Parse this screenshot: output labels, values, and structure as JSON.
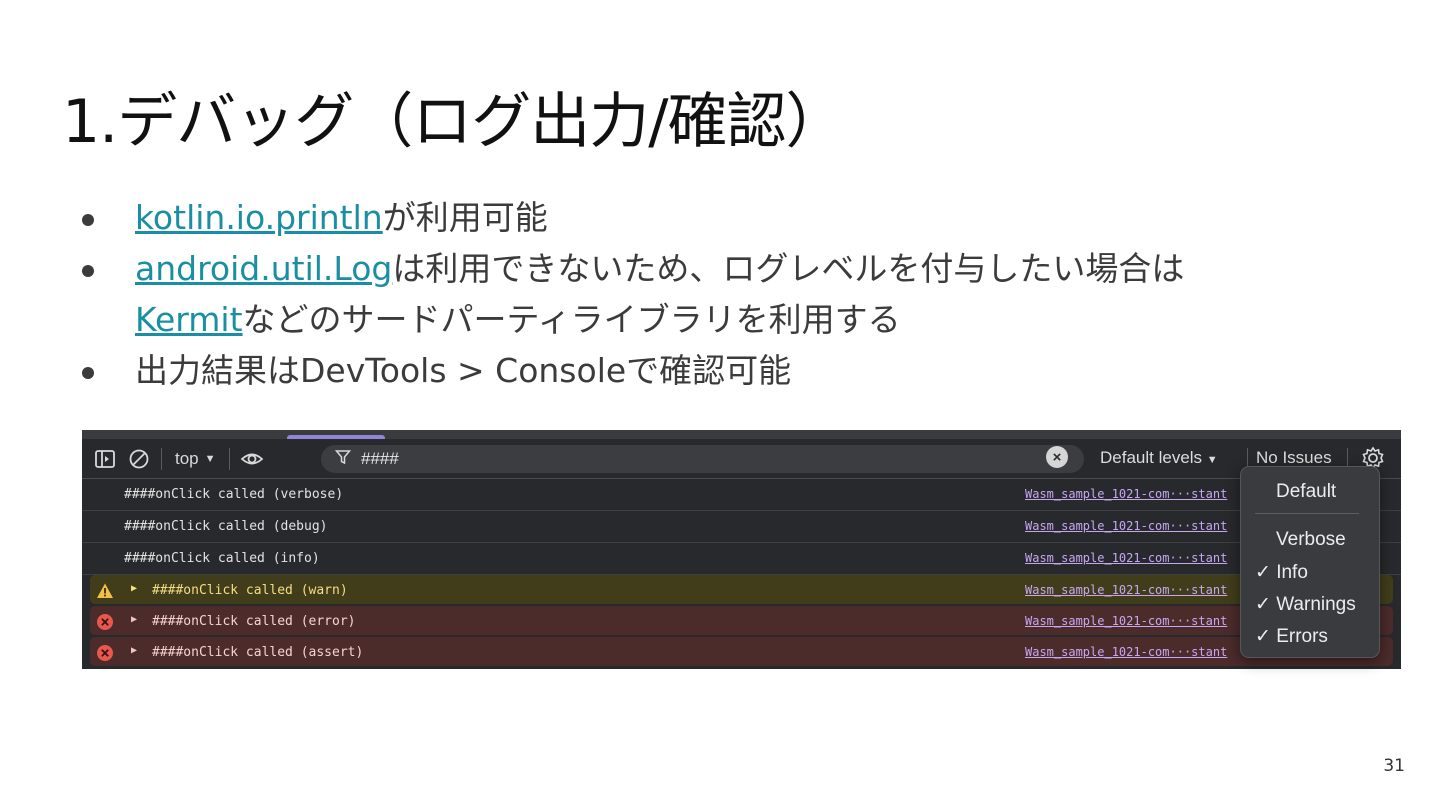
{
  "slide": {
    "title": "1.デバッグ（ログ出力/確認）",
    "bullets": [
      {
        "link": "kotlin.io.println",
        "text": "が利用可能"
      },
      {
        "link": "android.util.Log",
        "text": "は利用できないため、ログレベルを付与したい場合は"
      },
      {
        "link": "Kermit",
        "text": "などのサードパーティライブラリを利用する"
      },
      {
        "text": "出力結果はDevTools > Consoleで確認可能"
      }
    ],
    "page_number": "31"
  },
  "devtools": {
    "toolbar": {
      "context": "top",
      "filter_value": "####",
      "levels_label": "Default levels",
      "issues_label": "No Issues"
    },
    "logs": [
      {
        "level": "verbose",
        "message": "####onClick called (verbose)",
        "source": "Wasm_sample_1021-com···stant"
      },
      {
        "level": "debug",
        "message": "####onClick called (debug)",
        "source": "Wasm_sample_1021-com···stant"
      },
      {
        "level": "info",
        "message": "####onClick called (info)",
        "source": "Wasm_sample_1021-com···stant"
      },
      {
        "level": "warn",
        "message": "####onClick called (warn)",
        "source": "Wasm_sample_1021-com···stant"
      },
      {
        "level": "error",
        "message": "####onClick called (error)",
        "source": "Wasm_sample_1021-com···stant"
      },
      {
        "level": "error",
        "message": "####onClick called (assert)",
        "source": "Wasm_sample_1021-com···stant"
      }
    ],
    "level_menu": {
      "default": "Default",
      "verbose": "Verbose",
      "info": "✓ Info",
      "warnings": "✓ Warnings",
      "errors": "✓ Errors"
    },
    "colors": {
      "panel_bg": "#28292c",
      "warn_bg": "#413d1a",
      "error_bg": "#4c2b2b",
      "link": "#c7a7f2",
      "accent": "#8e86d6"
    }
  }
}
